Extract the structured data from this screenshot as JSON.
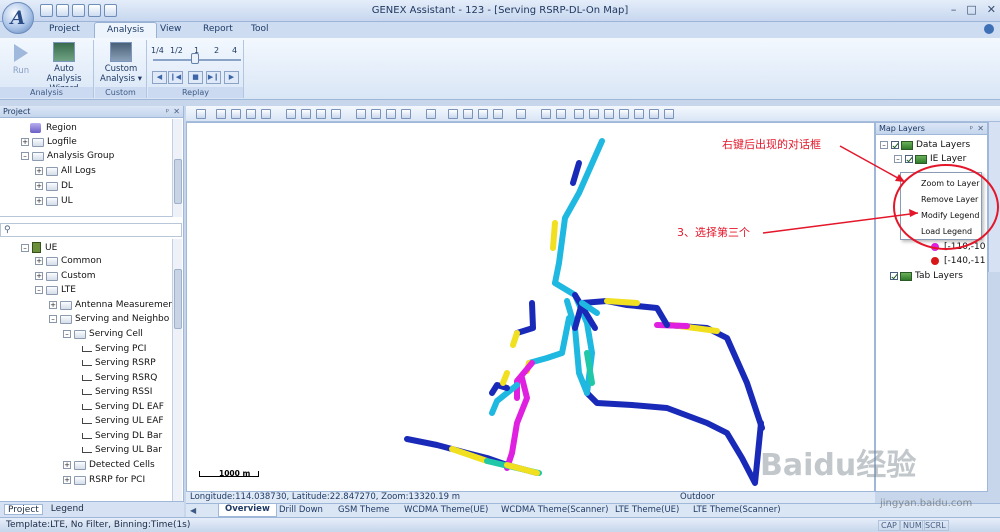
{
  "window": {
    "title": "GENEX Assistant - 123 - [Serving RSRP-DL-On Map]",
    "logo_letter": "A"
  },
  "ribbon": {
    "tabs": [
      "Project",
      "Analysis",
      "View",
      "Report",
      "Tool"
    ],
    "active_tab": "Analysis",
    "groups": {
      "analysis": {
        "label": "Analysis",
        "run": "Run",
        "auto_line1": "Auto Analysis",
        "auto_line2": "Wizard"
      },
      "custom": {
        "label": "Custom",
        "btn_line1": "Custom",
        "btn_line2": "Analysis ▾"
      },
      "replay": {
        "label": "Replay",
        "speeds": [
          "1/4",
          "1/2",
          "1",
          "2",
          "4"
        ]
      }
    }
  },
  "project_panel": {
    "title": "Project",
    "top_tree": [
      "Region",
      "Logfile",
      "Analysis Group",
      "All Logs",
      "DL",
      "UL"
    ],
    "bottom_tree": [
      "UE",
      "Common",
      "Custom",
      "LTE",
      "Antenna Measuremer",
      "Serving and Neighbo",
      "Serving Cell",
      "Serving PCI",
      "Serving RSRP",
      "Serving RSRQ",
      "Serving RSSI",
      "Serving DL EAF",
      "Serving UL EAF",
      "Serving DL Bar",
      "Serving UL Bar",
      "Detected Cells",
      "RSRP for PCI"
    ],
    "tabs": [
      "Project",
      "Legend"
    ]
  },
  "map": {
    "scale_label": "1000 m",
    "status": "Longitude:114.038730, Latitude:22.847270, Zoom:13320.19 m",
    "outdoor_label": "Outdoor"
  },
  "doc_tabs": [
    "Overview",
    "Drill Down",
    "GSM Theme",
    "WCDMA Theme(UE)",
    "WCDMA Theme(Scanner)",
    "LTE Theme(UE)",
    "LTE Theme(Scanner)"
  ],
  "map_layers": {
    "title": "Map Layers",
    "items": [
      "Data Layers",
      "IE Layer",
      "Tab Layers"
    ],
    "legend": [
      "[-110,-10",
      "[-140,-11"
    ],
    "legend_colors": [
      "#e020e0",
      "#d81818"
    ]
  },
  "context_menu": {
    "items": [
      "Zoom to Layer",
      "Remove Layer",
      "Modify Legend",
      "Load Legend"
    ]
  },
  "annotations": {
    "note1": "右键后出现的对话框",
    "note2": "3、选择第三个"
  },
  "watermark": {
    "text": "Baidu经验",
    "sub": "jingyan.baidu.com"
  },
  "status_bar": {
    "left": "Template:LTE,  No Filter,  Binning:Time(1s)",
    "indicators": [
      "CAP",
      "NUM",
      "SCRL"
    ]
  }
}
